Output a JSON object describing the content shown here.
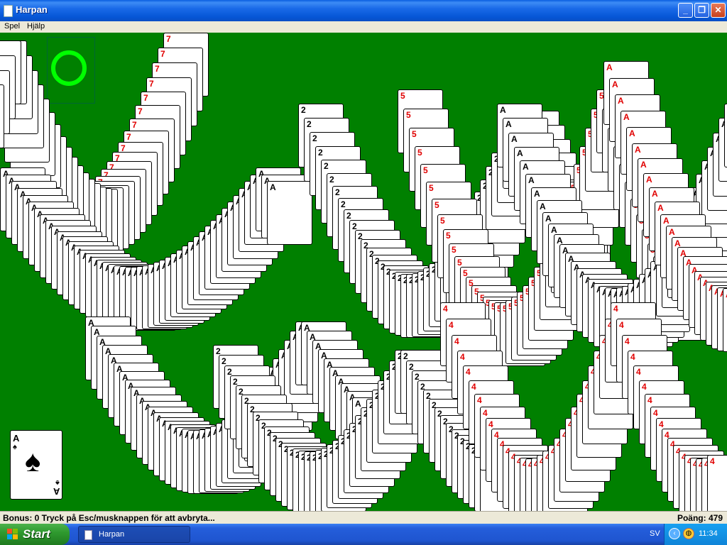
{
  "window": {
    "title": "Harpan",
    "minimize_glyph": "_",
    "maximize_glyph": "❐",
    "close_glyph": "✕"
  },
  "menu": {
    "items": [
      "Spel",
      "Hjälp"
    ]
  },
  "game": {
    "stock_marker_color": "#00ff00",
    "felt_color": "#008000",
    "card_rank_streaks": [
      "7",
      "A",
      "2",
      "A",
      "5",
      "4",
      "A",
      "A"
    ],
    "bottom_card": {
      "rank": "A",
      "suit": "♠"
    }
  },
  "status": {
    "message": "Bonus: 0  Tryck på Esc/musknappen för att avbryta...",
    "score": "Poäng: 479"
  },
  "taskbar": {
    "start_label": "Start",
    "task_label": "Harpan",
    "language": "SV",
    "clock": "11:34"
  }
}
